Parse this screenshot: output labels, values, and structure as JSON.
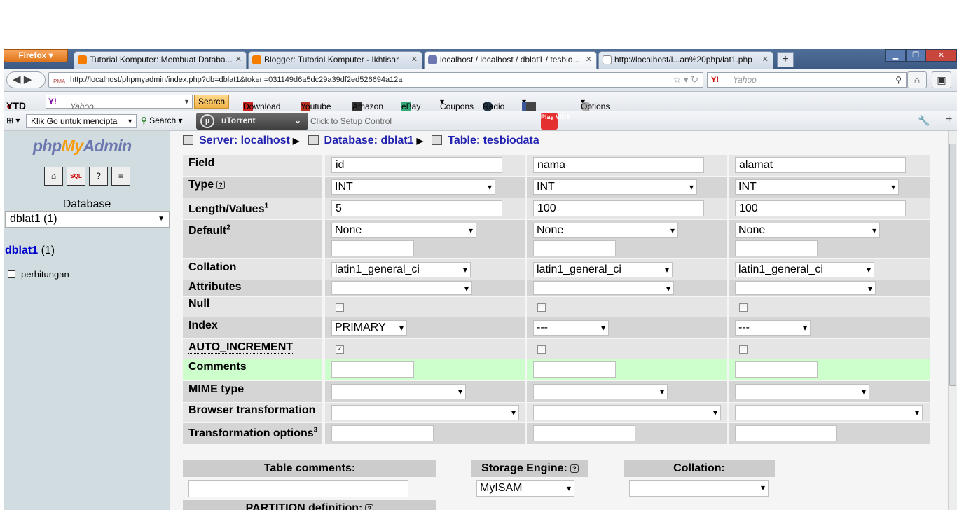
{
  "browser": {
    "firefox_label": "Firefox",
    "tabs": [
      {
        "title": "Tutorial Komputer: Membuat Databa...",
        "color": "#f57d00"
      },
      {
        "title": "Blogger: Tutorial Komputer - Ikhtisar",
        "color": "#f57d00"
      },
      {
        "title": "localhost / localhost / dblat1 / tesbio...",
        "color": "#6c78af"
      },
      {
        "title": "http://localhost/l...an%20php/lat1.php",
        "color": "#ffffff"
      }
    ],
    "close_glyph": "✕",
    "new_tab_glyph": "+",
    "url": "http://localhost/phpmyadmin/index.php?db=dblat1&token=031149d6a5dc29a39df2ed526694a12a",
    "search_placeholder": "Yahoo",
    "search_engine": "Y!"
  },
  "toolbar1": {
    "ytd": "YTD",
    "yahoo_placeholder": "Yahoo",
    "yahoo_logo": "Y!",
    "search_button": "Search",
    "items": [
      "Download",
      "Youtube",
      "Amazon",
      "eBay",
      "Coupons",
      "Radio",
      "Options"
    ]
  },
  "toolbar2": {
    "klik_go": "Klik Go untuk mencipta",
    "search": "Search",
    "utorrent": "uTorrent",
    "setup": "Click to Setup Control",
    "playvids": "Play VIDS"
  },
  "sidebar": {
    "logo_php": "php",
    "logo_my": "My",
    "logo_admin": "Admin",
    "database_label": "Database",
    "database_select": "dblat1 (1)",
    "db_name": "dblat1",
    "db_count": "(1)",
    "table": "perhitungan"
  },
  "breadcrumb": {
    "server": "Server: localhost",
    "database": "Database: dblat1",
    "table": "Table: tesbiodata"
  },
  "form": {
    "labels": {
      "field": "Field",
      "type": "Type",
      "length": "Length/Values",
      "length_sup": "1",
      "default": "Default",
      "default_sup": "2",
      "collation": "Collation",
      "attributes": "Attributes",
      "null": "Null",
      "index": "Index",
      "auto_increment": "AUTO_INCREMENT",
      "comments": "Comments",
      "mime": "MIME type",
      "browser_transformation": "Browser transformation",
      "transformation_options": "Transformation options",
      "transformation_sup": "3"
    },
    "columns": [
      {
        "field": "id",
        "type": "INT",
        "length": "5",
        "default": "None",
        "collation": "latin1_general_ci",
        "index": "PRIMARY",
        "auto_increment": true
      },
      {
        "field": "nama",
        "type": "INT",
        "length": "100",
        "default": "None",
        "collation": "latin1_general_ci",
        "index": "---",
        "auto_increment": false
      },
      {
        "field": "alamat",
        "type": "INT",
        "length": "100",
        "default": "None",
        "collation": "latin1_general_ci",
        "index": "---",
        "auto_increment": false
      }
    ]
  },
  "bottom": {
    "table_comments": "Table comments:",
    "storage_engine": "Storage Engine:",
    "storage_value": "MyISAM",
    "collation": "Collation:",
    "partition": "PARTITION definition:"
  },
  "colors": {
    "row_light": "#e5e5e5",
    "row_dark": "#d5d5d5",
    "row_green": "#ccffcc",
    "sidebar": "#d0dce0",
    "link": "#2222b0"
  }
}
